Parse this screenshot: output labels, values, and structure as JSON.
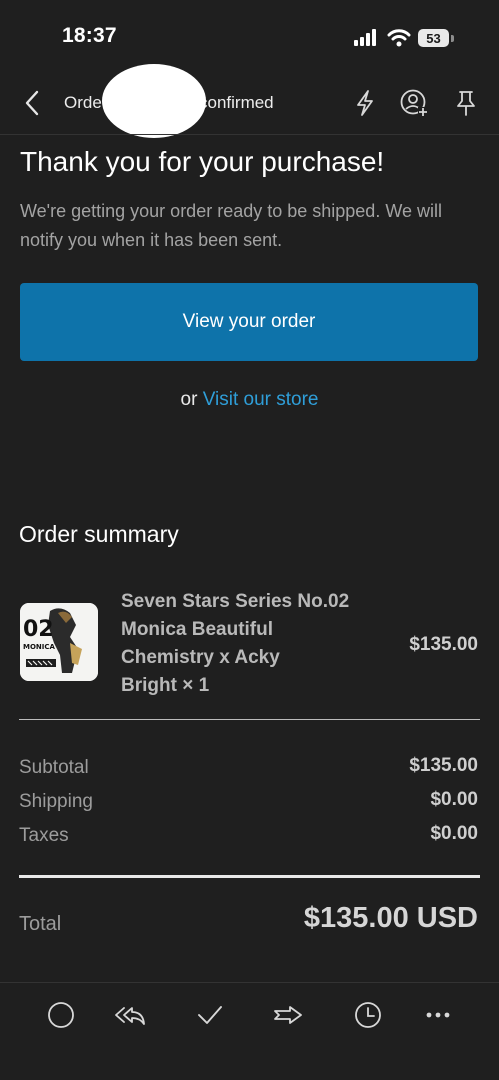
{
  "status_bar": {
    "time": "18:37",
    "battery": "53"
  },
  "header": {
    "subject_start": "Orde",
    "subject_end": "confirmed"
  },
  "email": {
    "heading": "Thank you for your purchase!",
    "message": "We're getting your order ready to be shipped. We will notify you when it has been sent.",
    "view_order_label": "View your order",
    "or_text": "or",
    "store_link": "Visit our store"
  },
  "summary": {
    "title": "Order summary",
    "product": {
      "thumb_number": "02",
      "thumb_label": "MONICA",
      "name_line1": "Seven Stars Series No.02",
      "name_line2": "Monica Beautiful",
      "name_line3": "Chemistry x Acky",
      "name_line4": "Bright × 1",
      "price": "$135.00"
    },
    "rows": [
      {
        "label": "Subtotal",
        "value": "$135.00"
      },
      {
        "label": "Shipping",
        "value": "$0.00"
      },
      {
        "label": "Taxes",
        "value": "$0.00"
      }
    ],
    "total_label": "Total",
    "total_value": "$135.00 USD"
  },
  "toolbar": {
    "icons": [
      "circle-icon",
      "reply-all-icon",
      "checkmark-icon",
      "forward-icon",
      "clock-icon",
      "more-icon"
    ]
  },
  "colors": {
    "background": "#1f1f1f",
    "button": "#0e73aa",
    "link": "#2f9ed8"
  }
}
